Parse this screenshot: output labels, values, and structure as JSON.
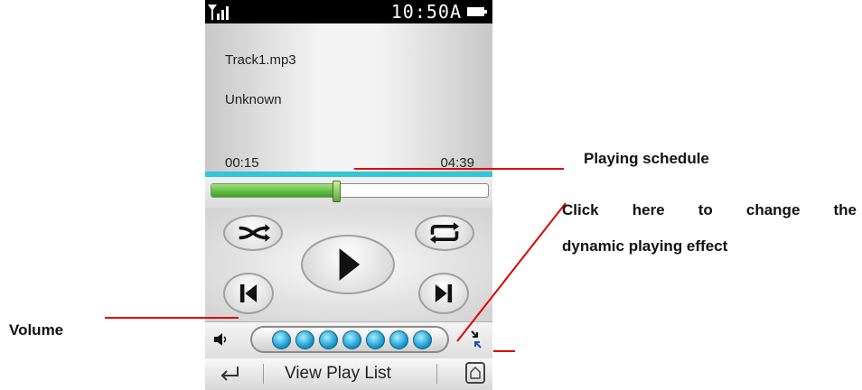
{
  "status_bar": {
    "time": "10:50A"
  },
  "player": {
    "track_name": "Track1.mp3",
    "artist": "Unknown",
    "elapsed": "00:15",
    "total": "04:39",
    "progress_fraction": 0.45
  },
  "controls": {
    "shuffle_icon": "shuffle-icon",
    "repeat_icon": "repeat-icon",
    "play_icon": "play-icon",
    "prev_icon": "previous-track-icon",
    "next_icon": "next-track-icon"
  },
  "volume": {
    "level_dots": 7,
    "icon": "speaker-icon",
    "effect_icon": "compress-arrows-icon"
  },
  "bottom_bar": {
    "view_play_list": "View Play List",
    "back_icon": "back-arrow-icon",
    "home_icon": "home-icon"
  },
  "annotations": {
    "playing_schedule": "Playing schedule",
    "click_here": "Click here to change the",
    "dynamic_effect": "dynamic playing effect",
    "volume": "Volume"
  },
  "colors": {
    "progress_line": "#34c6d4",
    "progress_fill": "#3ba21f",
    "volume_dot": "#0f8fc8",
    "annotation_line": "#e00000"
  }
}
